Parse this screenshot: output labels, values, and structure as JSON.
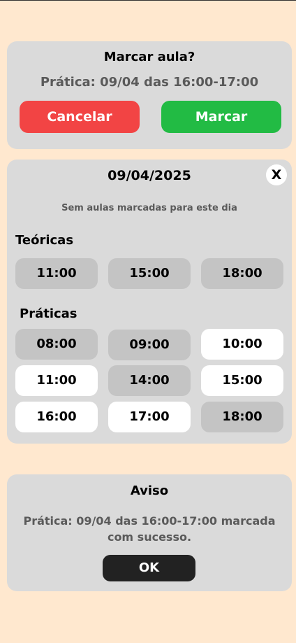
{
  "confirm_dialog": {
    "title": "Marcar aula?",
    "message": "Prática: 09/04 das 16:00-17:00",
    "cancel_label": "Cancelar",
    "confirm_label": "Marcar",
    "cancel_color": "#F24444",
    "confirm_color": "#22BB44"
  },
  "schedule": {
    "date": "09/04/2025",
    "close_label": "X",
    "empty_message": "Sem aulas marcadas para este dia",
    "theory": {
      "label": "Teóricas",
      "slots": [
        {
          "time": "11:00",
          "status": "taken"
        },
        {
          "time": "15:00",
          "status": "taken"
        },
        {
          "time": "18:00",
          "status": "taken"
        }
      ]
    },
    "practice": {
      "label": "Práticas",
      "slots": [
        {
          "time": "08:00",
          "status": "taken"
        },
        {
          "time": "09:00",
          "status": "taken"
        },
        {
          "time": "10:00",
          "status": "free"
        },
        {
          "time": "11:00",
          "status": "free"
        },
        {
          "time": "14:00",
          "status": "taken"
        },
        {
          "time": "15:00",
          "status": "free"
        },
        {
          "time": "16:00",
          "status": "free"
        },
        {
          "time": "17:00",
          "status": "free"
        },
        {
          "time": "18:00",
          "status": "taken"
        }
      ]
    }
  },
  "notice_dialog": {
    "title": "Aviso",
    "message": "Prática: 09/04 das 16:00-17:00 marcada com sucesso.",
    "ok_label": "OK"
  },
  "colors": {
    "background": "#FFE8CF",
    "card": "#DADADA",
    "slot_taken": "#C4C4C4",
    "slot_free": "#FFFFFF"
  }
}
